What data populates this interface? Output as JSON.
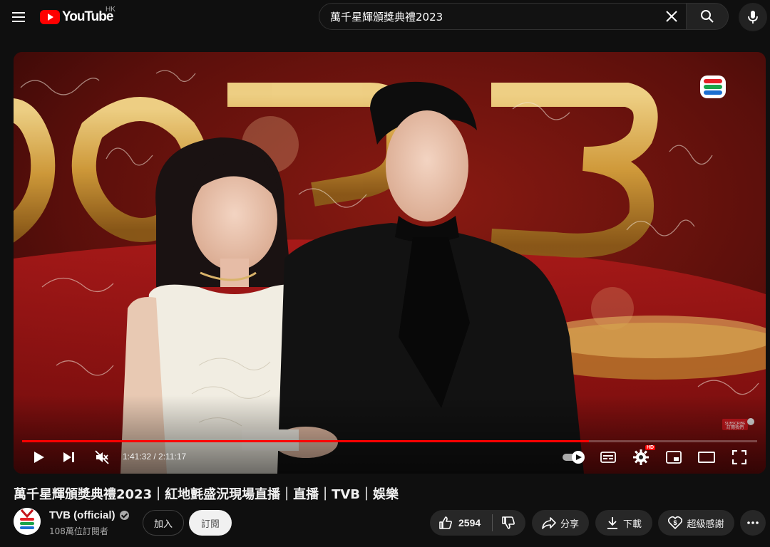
{
  "header": {
    "logo_text": "YouTube",
    "region": "HK",
    "search_value": "萬千星輝頒獎典禮2023",
    "icons": [
      "menu-icon",
      "youtube-logo",
      "clear-icon",
      "search-icon",
      "mic-icon"
    ]
  },
  "player": {
    "progress_fraction": 0.771,
    "current_time": "1:41:32",
    "duration": "2:11:17",
    "time_display": "1:41:32 / 2:11:17",
    "hd_badge": "HD",
    "autoplay_on": true,
    "icons": [
      "play-icon",
      "next-icon",
      "mute-icon",
      "autoplay-toggle",
      "subtitles-icon",
      "settings-icon",
      "miniplayer-icon",
      "theater-icon",
      "fullscreen-icon"
    ],
    "colors": {
      "progress": "#ff0000"
    }
  },
  "video": {
    "title": "萬千星輝頒獎典禮2023｜紅地氈盛況現場直播｜直播｜TVB｜娛樂"
  },
  "channel": {
    "name": "TVB (official)",
    "subscribers": "108萬位訂閱者",
    "verified": true
  },
  "actions": {
    "join": "加入",
    "subscribe": "訂閱",
    "likes": "2594",
    "share": "分享",
    "download": "下載",
    "super_thanks": "超級感謝"
  }
}
